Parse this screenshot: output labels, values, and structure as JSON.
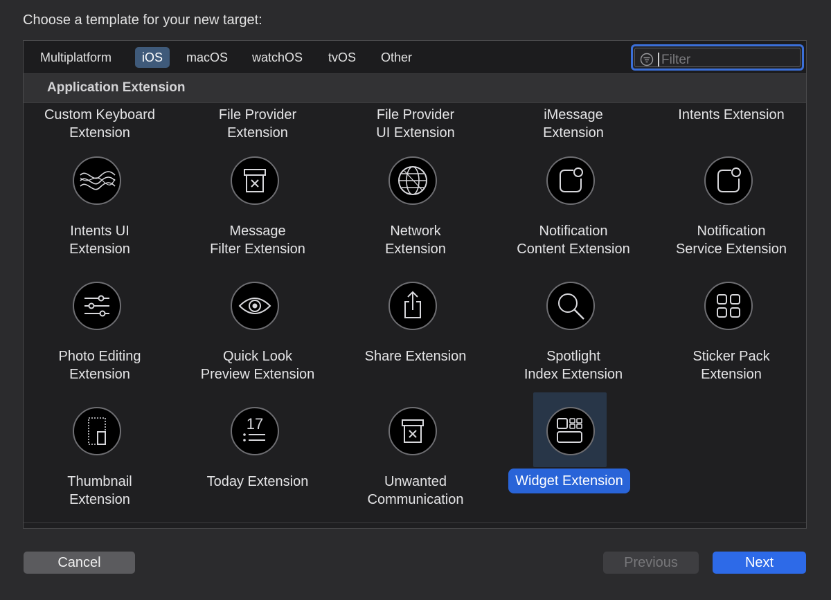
{
  "heading": "Choose a template for your new target:",
  "tabs": [
    {
      "label": "Multiplatform"
    },
    {
      "label": "iOS"
    },
    {
      "label": "macOS"
    },
    {
      "label": "watchOS"
    },
    {
      "label": "tvOS"
    },
    {
      "label": "Other"
    }
  ],
  "selected_tab": "iOS",
  "filter": {
    "placeholder": "Filter",
    "value": ""
  },
  "section": {
    "title": "Application Extension"
  },
  "cut_off_row": [
    {
      "label": "Custom Keyboard\nExtension"
    },
    {
      "label": "File Provider\nExtension"
    },
    {
      "label": "File Provider\nUI Extension"
    },
    {
      "label": "iMessage\nExtension"
    },
    {
      "label": "Intents Extension"
    }
  ],
  "templates": [
    {
      "label": "Intents UI\nExtension",
      "icon": "waves-icon"
    },
    {
      "label": "Message\nFilter Extension",
      "icon": "filter-box-icon"
    },
    {
      "label": "Network\nExtension",
      "icon": "globe-icon"
    },
    {
      "label": "Notification\nContent Extension",
      "icon": "notification-icon"
    },
    {
      "label": "Notification\nService Extension",
      "icon": "notification-icon"
    },
    {
      "label": "Photo Editing\nExtension",
      "icon": "sliders-icon"
    },
    {
      "label": "Quick Look\nPreview Extension",
      "icon": "eye-icon"
    },
    {
      "label": "Share Extension",
      "icon": "share-icon"
    },
    {
      "label": "Spotlight\nIndex Extension",
      "icon": "magnifier-icon"
    },
    {
      "label": "Sticker Pack\nExtension",
      "icon": "grid-squares-icon"
    },
    {
      "label": "Thumbnail\nExtension",
      "icon": "thumbnail-icon"
    },
    {
      "label": "Today Extension",
      "icon": "calendar-list-icon"
    },
    {
      "label": "Unwanted\nCommunication",
      "icon": "filter-box-icon"
    },
    {
      "label": "Widget Extension",
      "icon": "widget-icon",
      "selected": true
    }
  ],
  "buttons": {
    "cancel": "Cancel",
    "previous": "Previous",
    "next": "Next"
  },
  "colors": {
    "accent": "#2964d8",
    "selected_tab": "#3f5a7a",
    "background": "#2b2b2d"
  }
}
